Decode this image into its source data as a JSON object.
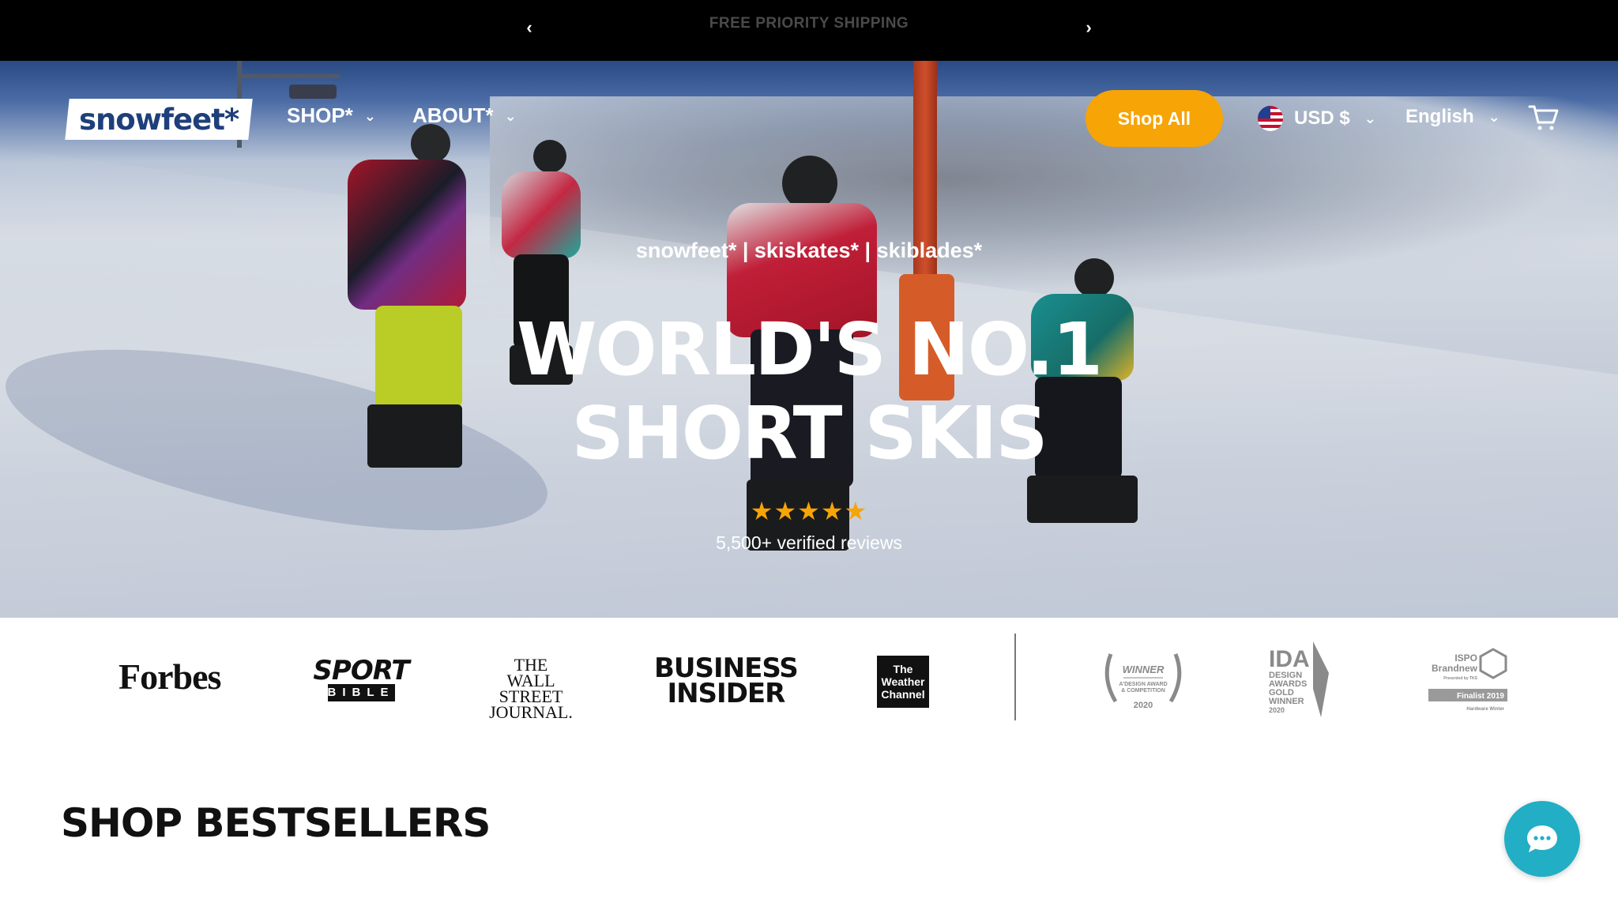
{
  "announcement": {
    "text": "FREE PRIORITY SHIPPING",
    "prev_icon": "chevron-left-icon",
    "next_icon": "chevron-right-icon"
  },
  "header": {
    "logo_text": "snowfeet*",
    "nav": [
      {
        "label": "SHOP*",
        "icon": "chevron-down-icon"
      },
      {
        "label": "ABOUT*",
        "icon": "chevron-down-icon"
      }
    ],
    "shop_all_label": "Shop All",
    "currency_label": "USD $",
    "language_label": "English",
    "cart_icon": "cart-icon"
  },
  "hero": {
    "tagline": "snowfeet* | skiskates* | skiblades*",
    "headline_line1": "WORLD'S NO.1",
    "headline_line2": "SHORT SKIS",
    "rating_stars": 5,
    "reviews_text": "5,500+ verified reviews"
  },
  "press": {
    "forbes": "Forbes",
    "sportbible_top": "SPORT",
    "sportbible_bottom": "BIBLE",
    "wsj_line1": "THE",
    "wsj_line2": "WALL STREET",
    "wsj_line3": "JOURNAL.",
    "bi_line1": "BUSINESS",
    "bi_line2": "INSIDER",
    "twc_line1": "The",
    "twc_line2": "Weather",
    "twc_line3": "Channel",
    "award1_title": "WINNER",
    "award1_sub1": "A'DESIGN AWARD",
    "award1_sub2": "& COMPETITION",
    "award1_year": "2020",
    "award2_line1": "IDA",
    "award2_line2": "DESIGN",
    "award2_line3": "AWARDS",
    "award2_line4": "GOLD",
    "award2_line5": "WINNER",
    "award2_line6": "2020",
    "award3_line1": "ISPO",
    "award3_line2": "Brandnew",
    "award3_line3": "Presented by TKS",
    "award3_line4": "Finalist 2019",
    "award3_line5": "Hardware Winter"
  },
  "sections": {
    "bestsellers_title": "SHOP BESTSELLERS"
  },
  "chat": {
    "icon": "chat-bubble-icon"
  },
  "colors": {
    "accent": "#f6a406",
    "chat": "#22aec4",
    "logo": "#1f3f7a"
  }
}
